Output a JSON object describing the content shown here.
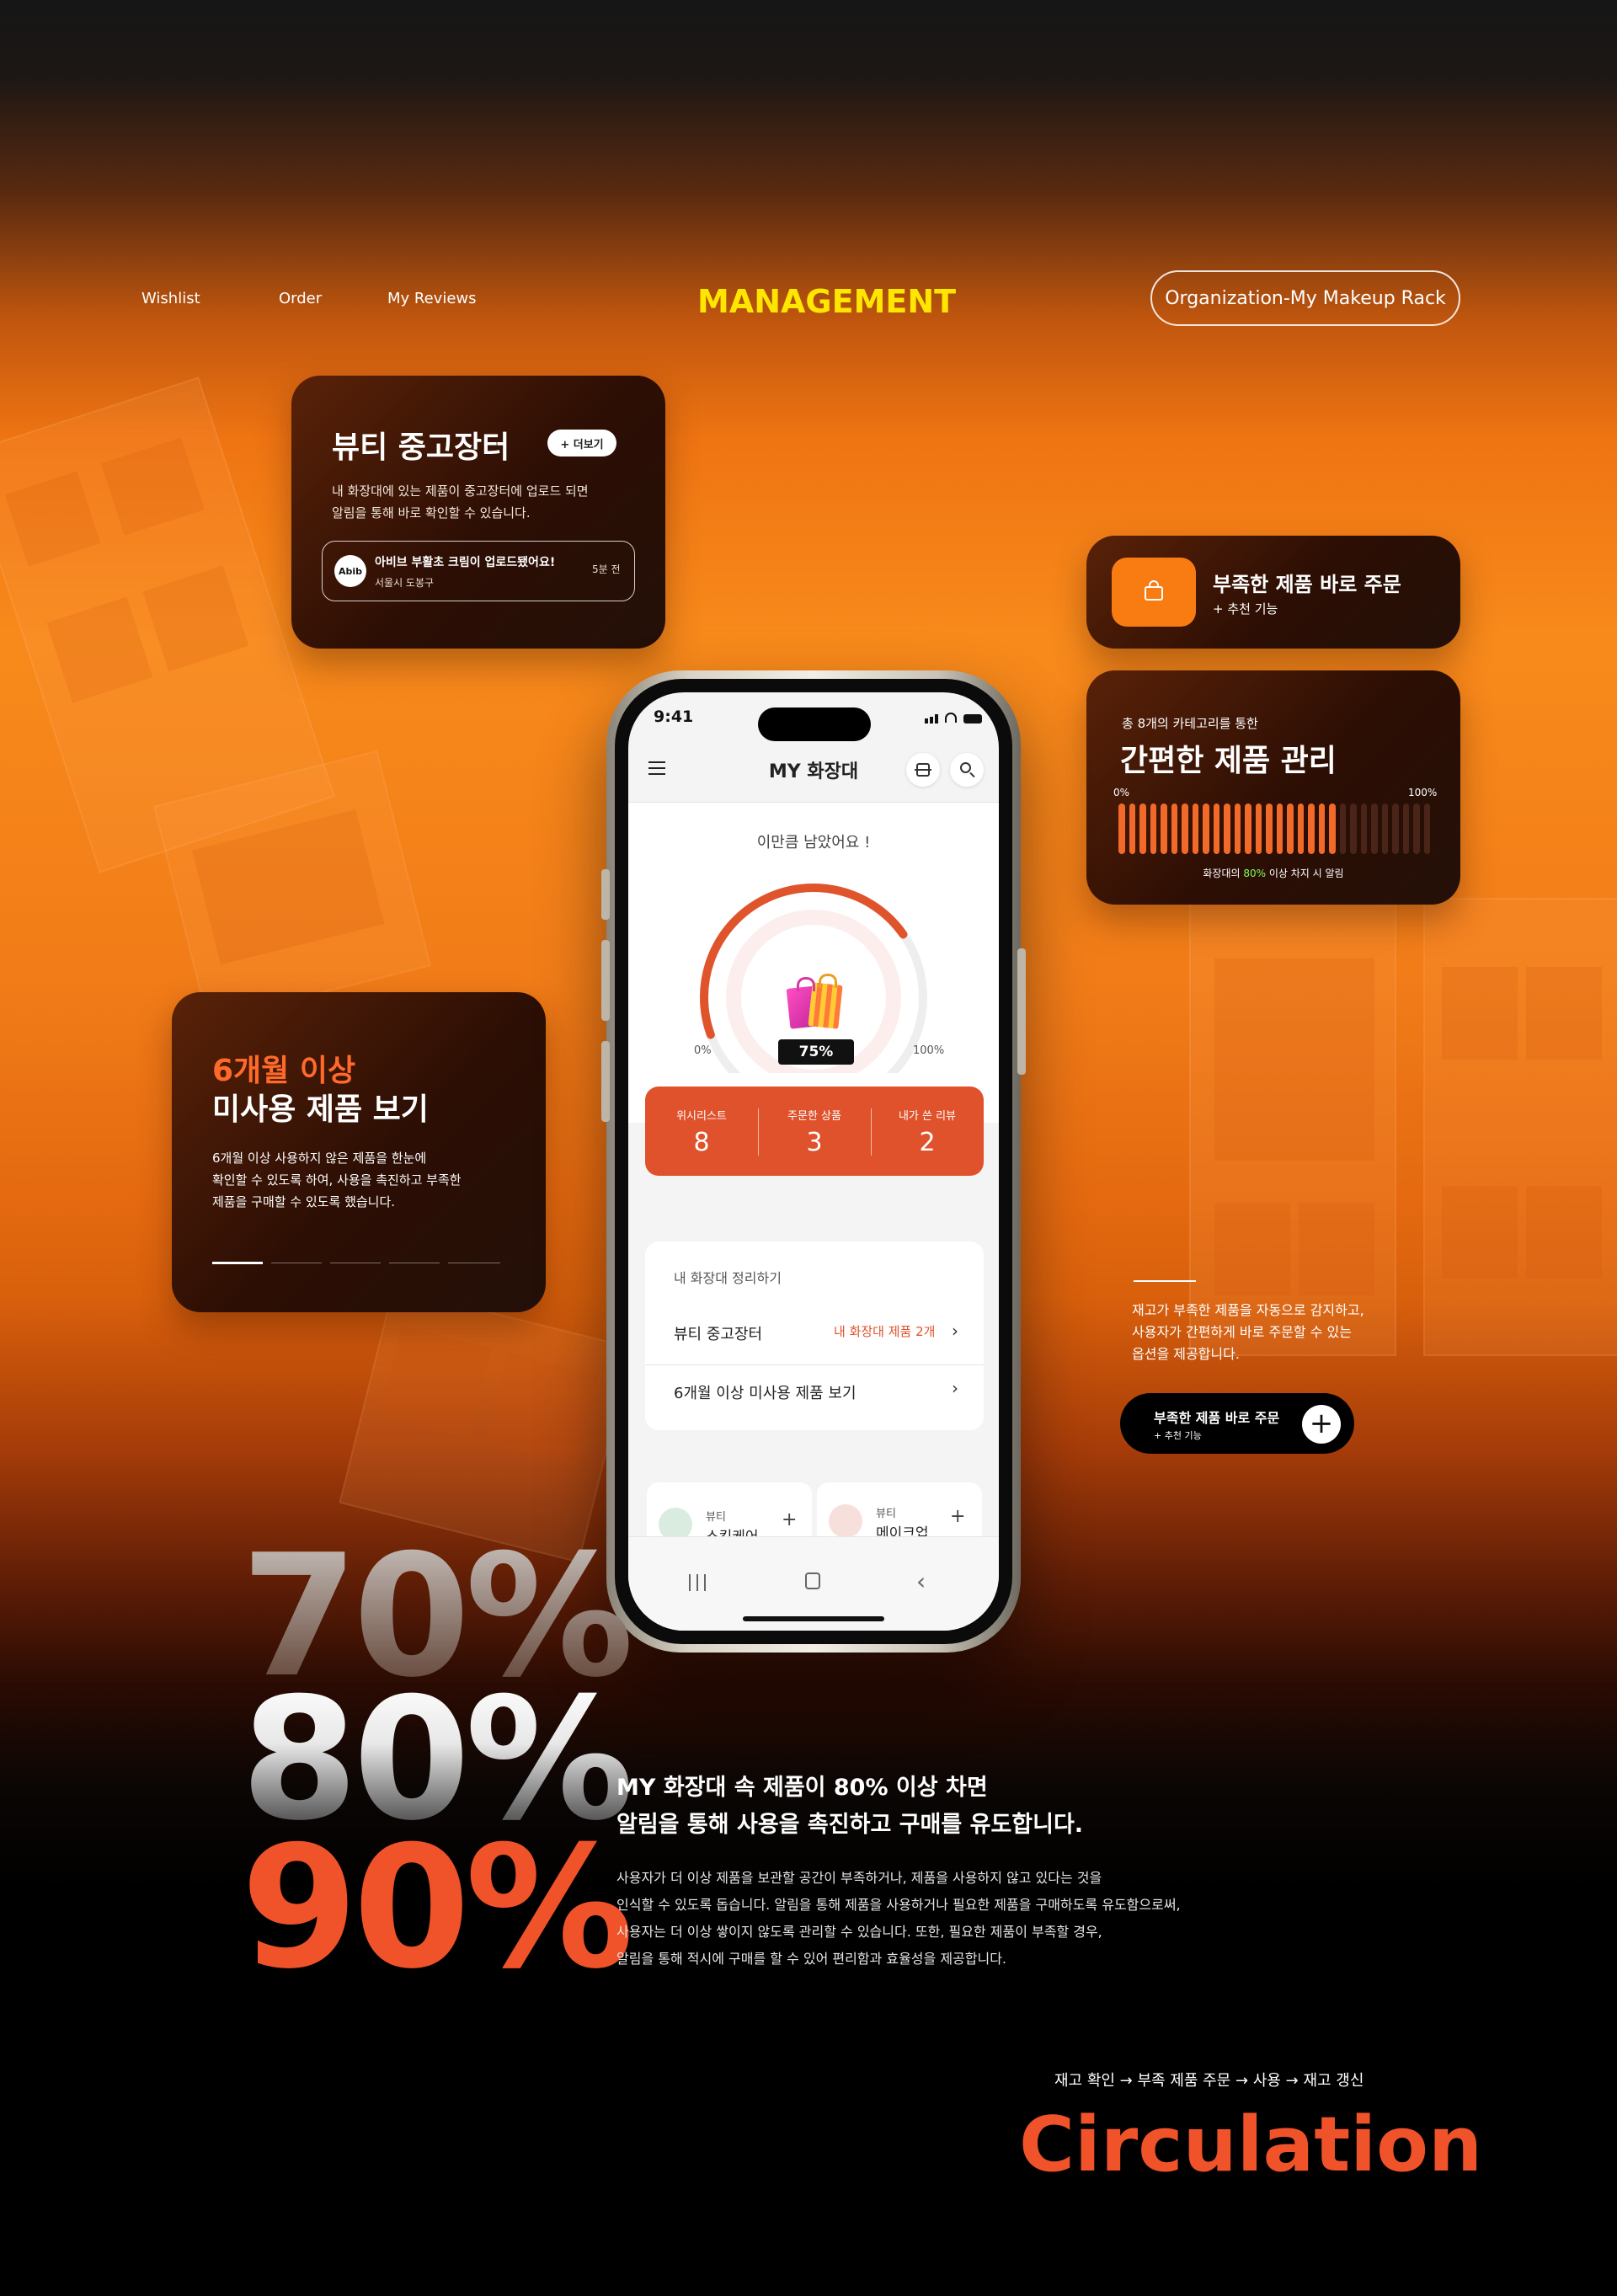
{
  "nav": {
    "links": [
      "Wishlist",
      "Order",
      "My Reviews"
    ],
    "brand": "MANAGEMENT",
    "pill_button": "Organization-My Makeup Rack"
  },
  "market_card": {
    "title": "뷰티 중고장터",
    "more_button": "+ 더보기",
    "desc1": "내 화장대에 있는 제품이 중고장터에 업로드 되면",
    "desc2": "알림을 통해 바로 확인할 수 있습니다.",
    "notif": {
      "logo": "Abib",
      "text": "아비브 부활초 크림이 업로드됐어요!",
      "location": "서울시 도봉구",
      "time": "5분 전"
    }
  },
  "order_card": {
    "title": "부족한 제품 바로 주문",
    "sub": "+ 추천 기능"
  },
  "manage_card": {
    "small": "총 8개의 카테고리를 통한",
    "title": "간편한 제품 관리",
    "min_label": "0%",
    "max_label": "100%",
    "level": 0.7,
    "note_pre": "화장대의 ",
    "note_pct": "80%",
    "note_post": " 이상 차지 시 알림"
  },
  "unused_card": {
    "title1": "6개월 이상",
    "title2": "미사용 제품 보기",
    "desc1": "6개월 이상 사용하지 않은 제품을 한눈에",
    "desc2": "확인할 수 있도록 하여, 사용을 촉진하고 부족한",
    "desc3": "제품을 구매할 수 있도록 했습니다."
  },
  "right_text": {
    "line1": "재고가 부족한 제품을 자동으로 감지하고,",
    "line2": "사용자가 간편하게 바로 주문할 수 있는",
    "line3": "옵션을 제공합니다.",
    "button_title": "부족한 제품 바로 주문",
    "button_sub": "+ 추천 기능"
  },
  "phone": {
    "time": "9:41",
    "header_title": "MY 화장대",
    "remaining_text": "이만큼 남았어요 !",
    "gauge_min": "0%",
    "gauge_max": "100%",
    "gauge_value": "75%",
    "gauge_level": 0.75,
    "stats": [
      {
        "label": "위시리스트",
        "value": "8"
      },
      {
        "label": "주문한 상품",
        "value": "3"
      },
      {
        "label": "내가 쓴 리뷰",
        "value": "2"
      }
    ],
    "section_title": "내 화장대 정리하기",
    "rows": [
      {
        "label": "뷰티 중고장터",
        "right": "내 화장대 제품 2개"
      },
      {
        "label": "6개월 이상 미사용 제품 보기",
        "right": ""
      }
    ],
    "cat_cards": [
      {
        "small": "뷰티",
        "big": "스킨케어"
      },
      {
        "small": "뷰티",
        "big": "메이크업"
      }
    ]
  },
  "stats_big": [
    "70%",
    "80%",
    "90%"
  ],
  "headline": {
    "line1": "MY 화장대 속 제품이 80% 이상 차면",
    "line2": "알림을 통해 사용을 촉진하고 구매를 유도합니다."
  },
  "body_lines": [
    "사용자가 더 이상 제품을 보관할 공간이 부족하거나, 제품을 사용하지 않고 있다는 것을",
    "인식할 수 있도록 돕습니다. 알림을 통해 제품을 사용하거나 필요한 제품을 구매하도록 유도함으로써,",
    "사용자는 더 이상 쌓이지 않도록 관리할 수 있습니다. 또한, 필요한 제품이 부족할 경우,",
    "알림을 통해 적시에 구매를 할 수 있어 편리함과 효율성을 제공합니다."
  ],
  "flow": "재고 확인 → 부족 제품 주문 → 사용 → 재고 갱신",
  "circulation": "Circulation",
  "colors": {
    "accent": "#f0522a",
    "brand_yellow": "#ffe600",
    "orange": "#f97c12"
  },
  "icons": [
    "menu-icon",
    "scan-icon",
    "search-icon",
    "shopping-bag-icon",
    "plus-icon",
    "chevron-right-icon",
    "home-icon",
    "back-icon",
    "recent-apps-icon"
  ]
}
